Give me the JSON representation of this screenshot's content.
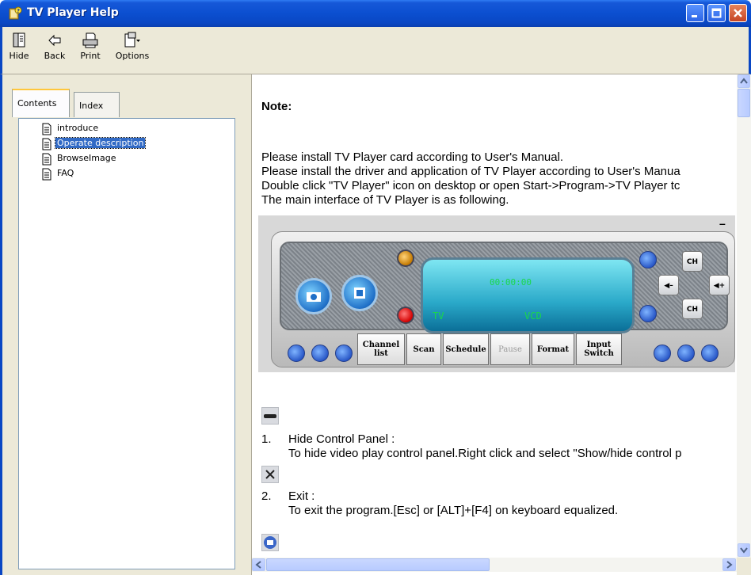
{
  "window": {
    "title": "TV Player Help",
    "accent": "#0a47c4"
  },
  "toolbar": {
    "hide_label": "Hide",
    "back_label": "Back",
    "print_label": "Print",
    "options_label": "Options"
  },
  "tabs": {
    "contents": "Contents",
    "index": "Index"
  },
  "tree": [
    {
      "label": "introduce",
      "icon": "page-icon"
    },
    {
      "label": "Operate description",
      "icon": "page-icon",
      "selected": true
    },
    {
      "label": "BrowseImage",
      "icon": "page-icon"
    },
    {
      "label": "FAQ",
      "icon": "page-icon"
    }
  ],
  "content": {
    "note": "Note:",
    "lines": [
      "Please install TV Player card according to User's Manual.",
      "Please install the driver and application of TV Player according to User's Manua",
      "Double click \"TV Player\" icon on desktop or open Start->Program->TV Player tc",
      "The main interface of TV Player is as following."
    ],
    "player": {
      "time": "00:00:00",
      "tv": "TV",
      "vcd": "VCD",
      "ch_up": "CH",
      "ch_down": "CH",
      "tabs": [
        "Channel\nlist",
        "Scan",
        "Schedule",
        "Pause",
        "Format",
        "Input\nSwitch"
      ]
    },
    "items": [
      {
        "num": "1.",
        "title": "Hide Control Panel :",
        "desc": "To hide video play control panel.Right click and select \"Show/hide control p"
      },
      {
        "num": "2.",
        "title": "Exit :",
        "desc": "To exit the program.[Esc] or [ALT]+[F4] on keyboard equalized."
      }
    ]
  }
}
